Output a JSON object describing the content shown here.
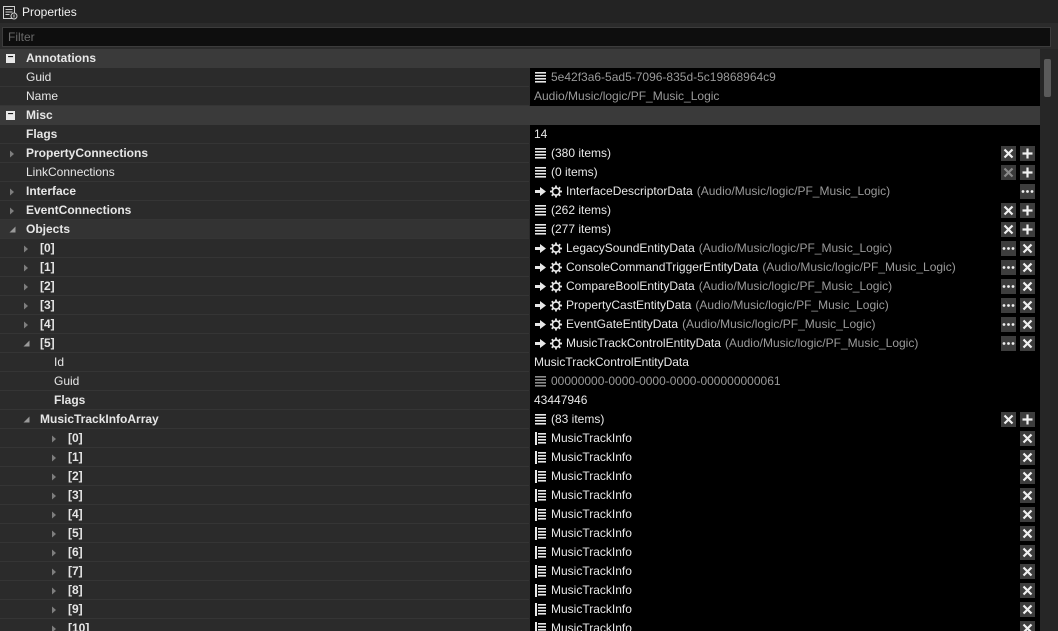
{
  "window": {
    "title": "Properties"
  },
  "filter": {
    "placeholder": "Filter",
    "value": ""
  },
  "rows": [
    {
      "kind": "cat",
      "label": "Annotations"
    },
    {
      "kind": "prop",
      "indent": 0,
      "label": "Guid",
      "bold": false,
      "expander": "none",
      "value": {
        "icon": "list-icon",
        "text": "5e42f3a6-5ad5-7096-835d-5c19868964c9",
        "dim": true
      }
    },
    {
      "kind": "prop",
      "indent": 0,
      "label": "Name",
      "bold": false,
      "expander": "none",
      "value": {
        "text": "Audio/Music/logic/PF_Music_Logic",
        "dim": true
      }
    },
    {
      "kind": "cat",
      "label": "Misc"
    },
    {
      "kind": "prop",
      "indent": 0,
      "label": "Flags",
      "bold": true,
      "expander": "none",
      "value": {
        "text": "14"
      }
    },
    {
      "kind": "prop",
      "indent": 0,
      "label": "PropertyConnections",
      "bold": true,
      "expander": "collapsed",
      "value": {
        "icon": "list-icon",
        "text": "(380 items)"
      },
      "buttons": [
        "clear",
        "add"
      ]
    },
    {
      "kind": "prop",
      "indent": 0,
      "label": "LinkConnections",
      "bold": false,
      "expander": "none",
      "value": {
        "icon": "list-icon",
        "text": "(0 items)"
      },
      "buttons": [
        "clear-disabled",
        "add"
      ]
    },
    {
      "kind": "prop",
      "indent": 0,
      "label": "Interface",
      "bold": true,
      "expander": "collapsed",
      "value": {
        "icon": "ref-icon",
        "text": "InterfaceDescriptorData",
        "suffix": "(Audio/Music/logic/PF_Music_Logic)"
      },
      "buttons": [
        "more"
      ]
    },
    {
      "kind": "prop",
      "indent": 0,
      "label": "EventConnections",
      "bold": true,
      "expander": "collapsed",
      "value": {
        "icon": "list-icon",
        "text": "(262 items)"
      },
      "buttons": [
        "clear",
        "add"
      ]
    },
    {
      "kind": "prop",
      "indent": 0,
      "label": "Objects",
      "bold": true,
      "expander": "expanded",
      "sel": true,
      "value": {
        "icon": "list-icon",
        "text": "(277 items)"
      },
      "buttons": [
        "clear",
        "add"
      ]
    },
    {
      "kind": "prop",
      "indent": 1,
      "label": "[0]",
      "bold": true,
      "expander": "collapsed",
      "value": {
        "icon": "ref-icon",
        "text": "LegacySoundEntityData",
        "suffix": "(Audio/Music/logic/PF_Music_Logic)"
      },
      "buttons": [
        "more",
        "clear"
      ]
    },
    {
      "kind": "prop",
      "indent": 1,
      "label": "[1]",
      "bold": true,
      "expander": "collapsed",
      "value": {
        "icon": "ref-icon",
        "text": "ConsoleCommandTriggerEntityData",
        "suffix": "(Audio/Music/logic/PF_Music_Logic)"
      },
      "buttons": [
        "more",
        "clear"
      ]
    },
    {
      "kind": "prop",
      "indent": 1,
      "label": "[2]",
      "bold": true,
      "expander": "collapsed",
      "value": {
        "icon": "ref-icon",
        "text": "CompareBoolEntityData",
        "suffix": "(Audio/Music/logic/PF_Music_Logic)"
      },
      "buttons": [
        "more",
        "clear"
      ]
    },
    {
      "kind": "prop",
      "indent": 1,
      "label": "[3]",
      "bold": true,
      "expander": "collapsed",
      "value": {
        "icon": "ref-icon",
        "text": "PropertyCastEntityData",
        "suffix": "(Audio/Music/logic/PF_Music_Logic)"
      },
      "buttons": [
        "more",
        "clear"
      ]
    },
    {
      "kind": "prop",
      "indent": 1,
      "label": "[4]",
      "bold": true,
      "expander": "collapsed",
      "value": {
        "icon": "ref-icon",
        "text": "EventGateEntityData",
        "suffix": "(Audio/Music/logic/PF_Music_Logic)"
      },
      "buttons": [
        "more",
        "clear"
      ]
    },
    {
      "kind": "prop",
      "indent": 1,
      "label": "[5]",
      "bold": true,
      "expander": "expanded",
      "value": {
        "icon": "ref-icon",
        "text": "MusicTrackControlEntityData",
        "suffix": "(Audio/Music/logic/PF_Music_Logic)"
      },
      "buttons": [
        "more",
        "clear"
      ]
    },
    {
      "kind": "prop",
      "indent": 2,
      "label": "Id",
      "bold": false,
      "expander": "none",
      "value": {
        "text": "MusicTrackControlEntityData"
      }
    },
    {
      "kind": "prop",
      "indent": 2,
      "label": "Guid",
      "bold": false,
      "expander": "none",
      "value": {
        "icon": "list-icon-dim",
        "text": "00000000-0000-0000-0000-000000000061",
        "dim": true
      }
    },
    {
      "kind": "prop",
      "indent": 2,
      "label": "Flags",
      "bold": true,
      "expander": "none",
      "value": {
        "text": "43447946"
      }
    },
    {
      "kind": "prop",
      "indent": 1,
      "label": "MusicTrackInfoArray",
      "bold": true,
      "expander": "expanded",
      "value": {
        "icon": "list-icon",
        "text": "(83 items)"
      },
      "buttons": [
        "clear",
        "add"
      ]
    },
    {
      "kind": "prop",
      "indent": 3,
      "label": "[0]",
      "bold": true,
      "expander": "collapsed",
      "value": {
        "icon": "struct-icon",
        "text": "MusicTrackInfo"
      },
      "buttons": [
        "clear"
      ]
    },
    {
      "kind": "prop",
      "indent": 3,
      "label": "[1]",
      "bold": true,
      "expander": "collapsed",
      "value": {
        "icon": "struct-icon",
        "text": "MusicTrackInfo"
      },
      "buttons": [
        "clear"
      ]
    },
    {
      "kind": "prop",
      "indent": 3,
      "label": "[2]",
      "bold": true,
      "expander": "collapsed",
      "value": {
        "icon": "struct-icon",
        "text": "MusicTrackInfo"
      },
      "buttons": [
        "clear"
      ]
    },
    {
      "kind": "prop",
      "indent": 3,
      "label": "[3]",
      "bold": true,
      "expander": "collapsed",
      "value": {
        "icon": "struct-icon",
        "text": "MusicTrackInfo"
      },
      "buttons": [
        "clear"
      ]
    },
    {
      "kind": "prop",
      "indent": 3,
      "label": "[4]",
      "bold": true,
      "expander": "collapsed",
      "value": {
        "icon": "struct-icon",
        "text": "MusicTrackInfo"
      },
      "buttons": [
        "clear"
      ]
    },
    {
      "kind": "prop",
      "indent": 3,
      "label": "[5]",
      "bold": true,
      "expander": "collapsed",
      "value": {
        "icon": "struct-icon",
        "text": "MusicTrackInfo"
      },
      "buttons": [
        "clear"
      ]
    },
    {
      "kind": "prop",
      "indent": 3,
      "label": "[6]",
      "bold": true,
      "expander": "collapsed",
      "value": {
        "icon": "struct-icon",
        "text": "MusicTrackInfo"
      },
      "buttons": [
        "clear"
      ]
    },
    {
      "kind": "prop",
      "indent": 3,
      "label": "[7]",
      "bold": true,
      "expander": "collapsed",
      "value": {
        "icon": "struct-icon",
        "text": "MusicTrackInfo"
      },
      "buttons": [
        "clear"
      ]
    },
    {
      "kind": "prop",
      "indent": 3,
      "label": "[8]",
      "bold": true,
      "expander": "collapsed",
      "value": {
        "icon": "struct-icon",
        "text": "MusicTrackInfo"
      },
      "buttons": [
        "clear"
      ]
    },
    {
      "kind": "prop",
      "indent": 3,
      "label": "[9]",
      "bold": true,
      "expander": "collapsed",
      "value": {
        "icon": "struct-icon",
        "text": "MusicTrackInfo"
      },
      "buttons": [
        "clear"
      ]
    },
    {
      "kind": "prop",
      "indent": 3,
      "label": "[10]",
      "bold": true,
      "expander": "collapsed",
      "value": {
        "icon": "struct-icon",
        "text": "MusicTrackInfo"
      },
      "buttons": [
        "clear"
      ]
    }
  ]
}
